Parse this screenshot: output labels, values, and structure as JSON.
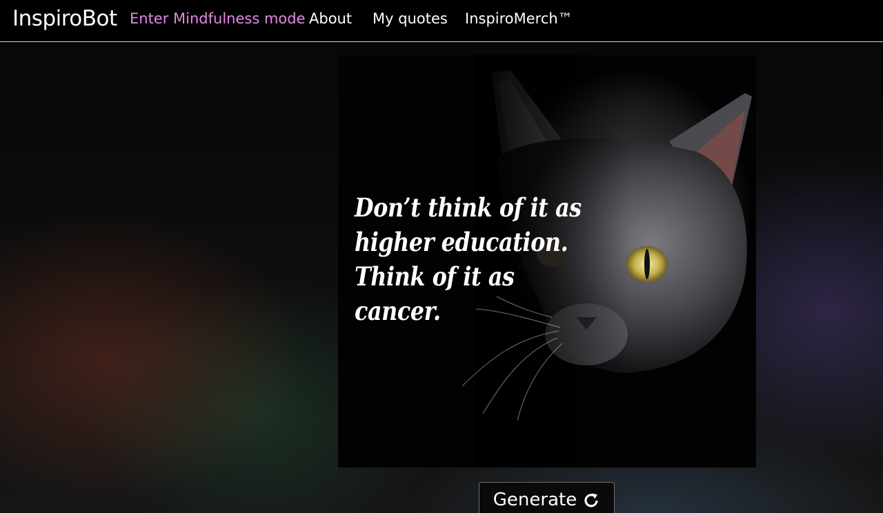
{
  "nav": {
    "brand": "InspiroBot",
    "items": [
      {
        "label": "Enter Mindfulness mode"
      },
      {
        "label": "About"
      },
      {
        "label": "My quotes"
      },
      {
        "label": "InspiroMerch™"
      }
    ],
    "accent_color": "#e58ae6"
  },
  "quote": {
    "lines": [
      "Don’t think of it as",
      "higher education.",
      "Think of it as",
      "cancer."
    ],
    "image_subject": "black-cat"
  },
  "generate": {
    "label": "Generate",
    "icon": "refresh-icon"
  }
}
